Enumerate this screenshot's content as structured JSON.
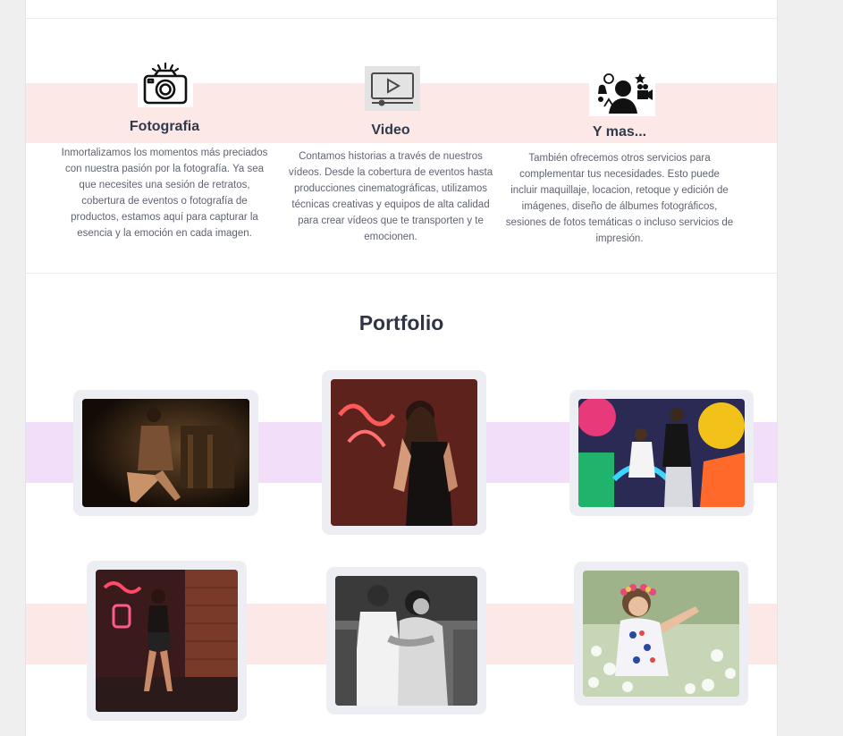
{
  "services": [
    {
      "title": "Fotografia",
      "icon": "camera-icon",
      "text": "Inmortalizamos los momentos más preciados con nuestra pasión por la fotografía. Ya sea que necesites una sesión de retratos, cobertura de eventos o fotografía de productos, estamos aquí para capturar la esencia y la emoción en cada imagen."
    },
    {
      "title": "Video",
      "icon": "video-player-icon",
      "text": "Contamos historias a través de nuestros vídeos. Desde la cobertura de eventos hasta producciones cinematográficas, utilizamos técnicas creativas y equipos de alta calidad para crear vídeos que te transporten y te emocionen."
    },
    {
      "title": "Y mas...",
      "icon": "services-person-icon",
      "text": "También ofrecemos otros servicios para complementar tus necesidades. Esto puede incluir maquillaje, locacion, retoque y edición de imágenes, diseño de álbumes fotográficos, sesiones de fotos temáticas o incluso servicios de impresión."
    }
  ],
  "portfolio": {
    "title": "Portfolio",
    "items": [
      {
        "name": "portfolio-photo-1",
        "subject": "woman-seated-dark-room"
      },
      {
        "name": "portfolio-photo-2",
        "subject": "woman-neon-lights"
      },
      {
        "name": "portfolio-photo-3",
        "subject": "women-colorful-mural"
      },
      {
        "name": "portfolio-photo-4",
        "subject": "woman-neon-brick-wall"
      },
      {
        "name": "portfolio-photo-5",
        "subject": "couple-black-white"
      },
      {
        "name": "portfolio-photo-6",
        "subject": "girl-flower-crown"
      }
    ]
  },
  "colors": {
    "band_pink": "#fce8e6",
    "band_lilac": "#f3defa",
    "card_bg": "#eceef3",
    "heading": "#2f3544"
  }
}
